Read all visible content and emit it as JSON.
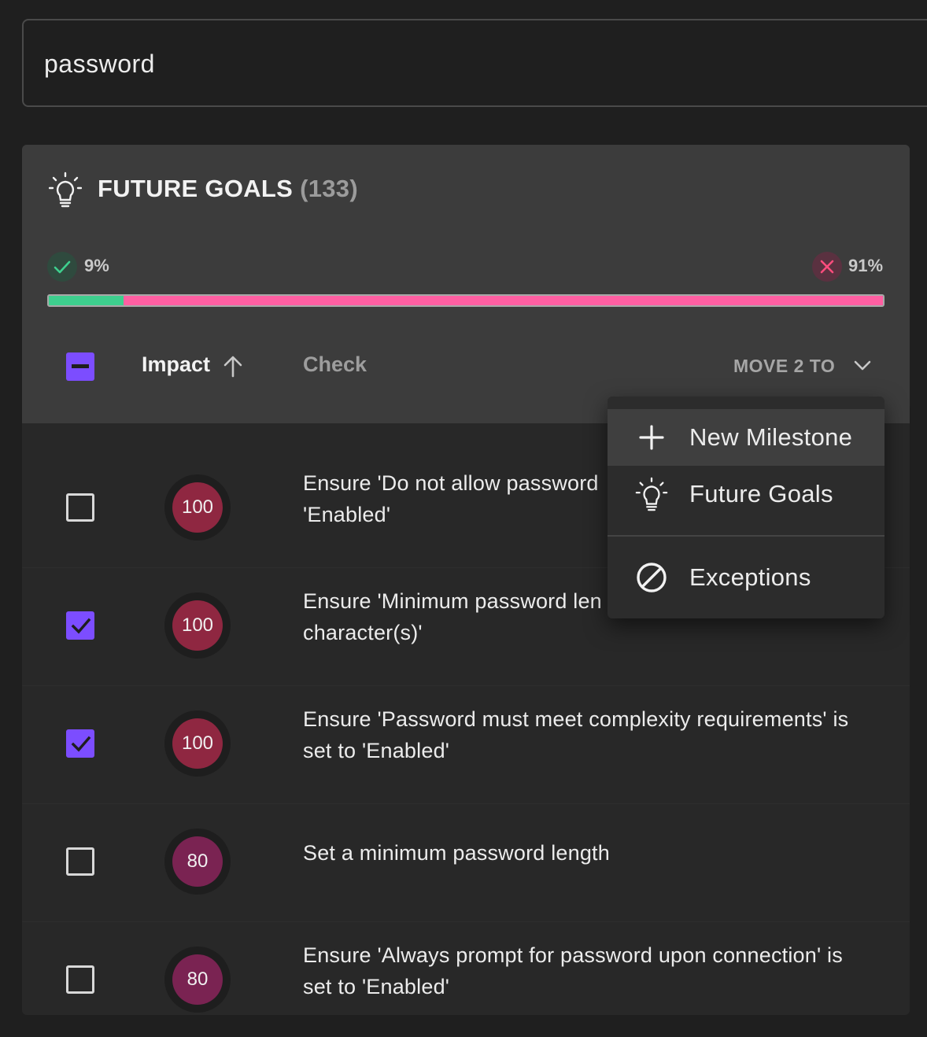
{
  "search": {
    "value": "password"
  },
  "section": {
    "title": "FUTURE GOALS",
    "count": "(133)"
  },
  "progress": {
    "pass_label": "9%",
    "fail_label": "91%",
    "pass_fraction": 0.09,
    "pass_color": "#3ecf8e",
    "fail_color": "#ff5fa2"
  },
  "table_header": {
    "impact_label": "Impact",
    "check_label": "Check",
    "move_label": "MOVE 2 TO"
  },
  "rows": [
    {
      "impact": "100",
      "text": "Ensure 'Do not allow password",
      "text2": "'Enabled'",
      "checked": false,
      "color": "#8f2741"
    },
    {
      "impact": "100",
      "text": "Ensure 'Minimum password len",
      "text2": "character(s)'",
      "checked": true,
      "color": "#8f2741"
    },
    {
      "impact": "100",
      "text": "Ensure 'Password must meet complexity requirements' is",
      "text2": "set to 'Enabled'",
      "checked": true,
      "color": "#8f2741"
    },
    {
      "impact": "80",
      "text": "Set a minimum password length",
      "text2": "",
      "checked": false,
      "color": "#7a2352"
    },
    {
      "impact": "80",
      "text": "Ensure 'Always prompt for password upon connection' is",
      "text2": "set to 'Enabled'",
      "checked": false,
      "color": "#7a2352"
    }
  ],
  "menu": {
    "items": [
      {
        "label": "New Milestone",
        "icon": "plus-icon"
      },
      {
        "label": "Future Goals",
        "icon": "lightbulb-icon"
      },
      {
        "label": "Exceptions",
        "icon": "block-icon"
      }
    ]
  },
  "colors": {
    "accent": "#7c4dff"
  }
}
